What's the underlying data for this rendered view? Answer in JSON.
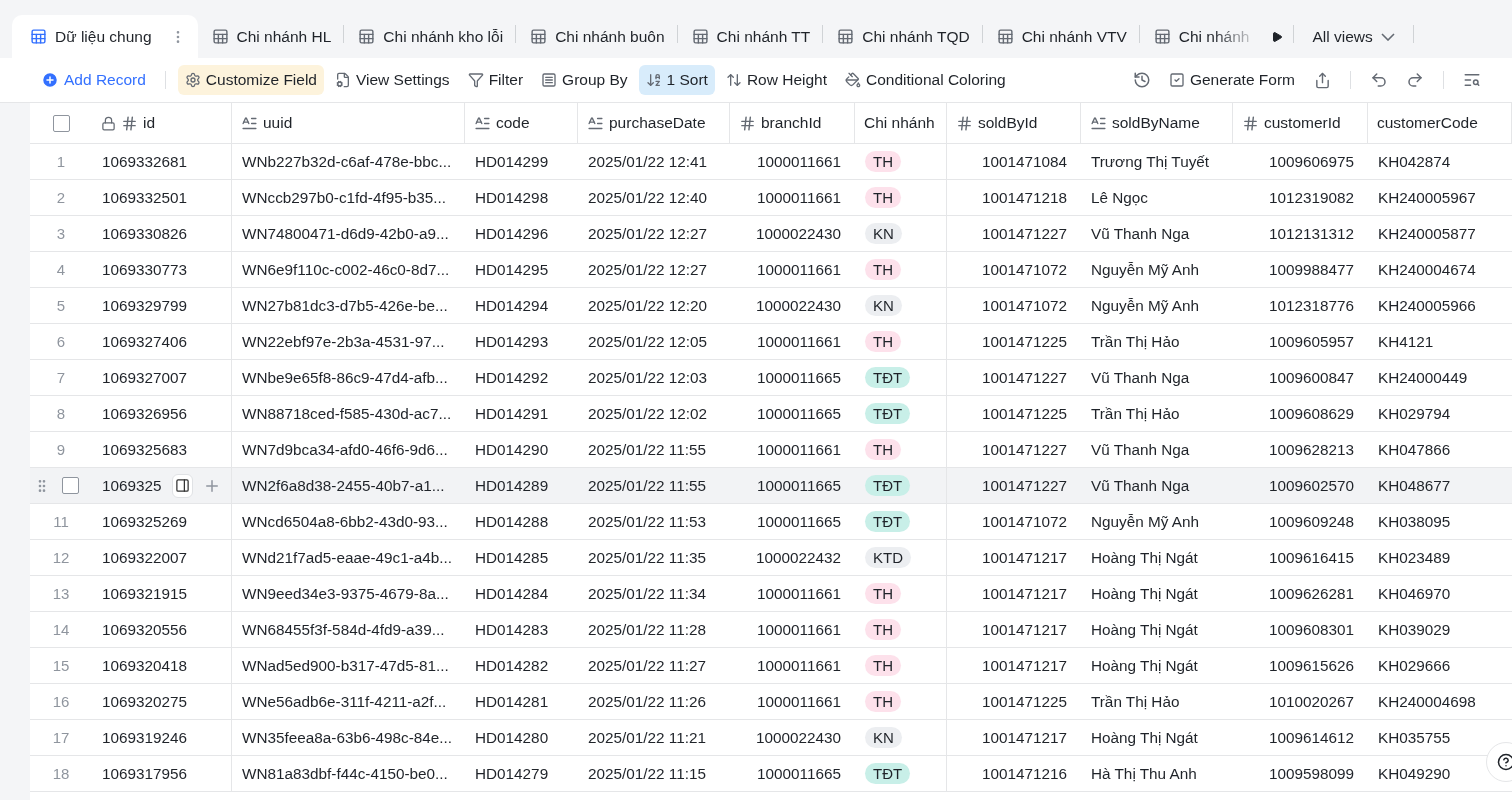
{
  "tabs": [
    {
      "label": "Dữ liệu chung",
      "selected": true
    },
    {
      "label": "Chi nhánh HL",
      "selected": false
    },
    {
      "label": "Chi nhánh kho lỗi",
      "selected": false
    },
    {
      "label": "Chi nhánh buôn",
      "selected": false
    },
    {
      "label": "Chi nhánh TT",
      "selected": false
    },
    {
      "label": "Chi nhánh TQD",
      "selected": false
    },
    {
      "label": "Chi nhánh VTV",
      "selected": false
    },
    {
      "label": "Chi nhánh",
      "selected": false
    }
  ],
  "all_views": "All views",
  "toolbar": [
    {
      "kind": "add",
      "label": "Add Record"
    },
    {
      "kind": "customize",
      "label": "Customize Field",
      "active": true
    },
    {
      "kind": "view-settings",
      "label": "View Settings",
      "active": false
    },
    {
      "kind": "filter",
      "label": "Filter",
      "active": false
    },
    {
      "kind": "group",
      "label": "Group By",
      "active": false
    },
    {
      "kind": "sort",
      "label": "1 Sort",
      "active": true
    },
    {
      "kind": "row-height",
      "label": "Row Height",
      "active": false
    },
    {
      "kind": "coloring",
      "label": "Conditional Coloring",
      "active": false
    }
  ],
  "generate_form": "Generate Form",
  "table": {
    "all_checked": false,
    "columns": [
      {
        "name": "id",
        "kind": "id"
      },
      {
        "name": "uuid",
        "kind": "text"
      },
      {
        "name": "code",
        "kind": "text"
      },
      {
        "name": "purchaseDate",
        "kind": "text"
      },
      {
        "name": "branchId",
        "kind": "number"
      },
      {
        "name": "Chi nhánh",
        "kind": "plain"
      },
      {
        "name": "soldById",
        "kind": "number"
      },
      {
        "name": "soldByName",
        "kind": "text"
      },
      {
        "name": "customerId",
        "kind": "number"
      },
      {
        "name": "customerCode",
        "kind": "plain"
      }
    ],
    "rows": [
      {
        "n": "1",
        "hovered": false,
        "cells": [
          "1069332681",
          "WNb227b32d-c6af-478e-bbc...",
          "HD014299",
          "2025/01/22 12:41",
          "1000011661",
          "TH",
          "1001471084",
          "Trương Thị Tuyết",
          "1009606975",
          "KH042874"
        ],
        "color": "#fde1eb"
      },
      {
        "n": "2",
        "hovered": false,
        "cells": [
          "1069332501",
          "WNccb297b0-c1fd-4f95-b35...",
          "HD014298",
          "2025/01/22 12:40",
          "1000011661",
          "TH",
          "1001471218",
          "Lê Ngọc",
          "1012319082",
          "KH240005967"
        ],
        "color": "#fde1eb"
      },
      {
        "n": "3",
        "hovered": false,
        "cells": [
          "1069330826",
          "WN74800471-d6d9-42b0-a9...",
          "HD014296",
          "2025/01/22 12:27",
          "1000022430",
          "KN",
          "1001471227",
          "Vũ Thanh Nga",
          "1012131312",
          "KH240005877"
        ],
        "color": "#eceef1"
      },
      {
        "n": "4",
        "hovered": false,
        "cells": [
          "1069330773",
          "WN6e9f110c-c002-46c0-8d7...",
          "HD014295",
          "2025/01/22 12:27",
          "1000011661",
          "TH",
          "1001471072",
          "Nguyễn Mỹ Anh",
          "1009988477",
          "KH240004674"
        ],
        "color": "#fde1eb"
      },
      {
        "n": "5",
        "hovered": false,
        "cells": [
          "1069329799",
          "WN27b81dc3-d7b5-426e-be...",
          "HD014294",
          "2025/01/22 12:20",
          "1000022430",
          "KN",
          "1001471072",
          "Nguyễn Mỹ Anh",
          "1012318776",
          "KH240005966"
        ],
        "color": "#eceef1"
      },
      {
        "n": "6",
        "hovered": false,
        "cells": [
          "1069327406",
          "WN22ebf97e-2b3a-4531-97...",
          "HD014293",
          "2025/01/22 12:05",
          "1000011661",
          "TH",
          "1001471225",
          "Trần Thị Hảo",
          "1009605957",
          "KH4121"
        ],
        "color": "#fde1eb"
      },
      {
        "n": "7",
        "hovered": false,
        "cells": [
          "1069327007",
          "WNbe9e65f8-86c9-47d4-afb...",
          "HD014292",
          "2025/01/22 12:03",
          "1000011665",
          "TĐT",
          "1001471227",
          "Vũ Thanh Nga",
          "1009600847",
          "KH24000449"
        ],
        "color": "#c8efe8"
      },
      {
        "n": "8",
        "hovered": false,
        "cells": [
          "1069326956",
          "WN88718ced-f585-430d-ac7...",
          "HD014291",
          "2025/01/22 12:02",
          "1000011665",
          "TĐT",
          "1001471225",
          "Trần Thị Hảo",
          "1009608629",
          "KH029794"
        ],
        "color": "#c8efe8"
      },
      {
        "n": "9",
        "hovered": false,
        "cells": [
          "1069325683",
          "WN7d9bca34-afd0-46f6-9d6...",
          "HD014290",
          "2025/01/22 11:55",
          "1000011661",
          "TH",
          "1001471227",
          "Vũ Thanh Nga",
          "1009628213",
          "KH047866"
        ],
        "color": "#fde1eb"
      },
      {
        "hovered": true,
        "checked": false,
        "cells": [
          "1069325",
          "WN2f6a8d38-2455-40b7-a1...",
          "HD014289",
          "2025/01/22 11:55",
          "1000011665",
          "TĐT",
          "1001471227",
          "Vũ Thanh Nga",
          "1009602570",
          "KH048677"
        ],
        "color": "#c8efe8"
      },
      {
        "n": "11",
        "hovered": false,
        "cells": [
          "1069325269",
          "WNcd6504a8-6bb2-43d0-93...",
          "HD014288",
          "2025/01/22 11:53",
          "1000011665",
          "TĐT",
          "1001471072",
          "Nguyễn Mỹ Anh",
          "1009609248",
          "KH038095"
        ],
        "color": "#c8efe8"
      },
      {
        "n": "12",
        "hovered": false,
        "cells": [
          "1069322007",
          "WNd21f7ad5-eaae-49c1-a4b...",
          "HD014285",
          "2025/01/22 11:35",
          "1000022432",
          "KTD",
          "1001471217",
          "Hoàng Thị Ngát",
          "1009616415",
          "KH023489"
        ],
        "color": "#eceef1"
      },
      {
        "n": "13",
        "hovered": false,
        "cells": [
          "1069321915",
          "WN9eed34e3-9375-4679-8a...",
          "HD014284",
          "2025/01/22 11:34",
          "1000011661",
          "TH",
          "1001471217",
          "Hoàng Thị Ngát",
          "1009626281",
          "KH046970"
        ],
        "color": "#fde1eb"
      },
      {
        "n": "14",
        "hovered": false,
        "cells": [
          "1069320556",
          "WN68455f3f-584d-4fd9-a39...",
          "HD014283",
          "2025/01/22 11:28",
          "1000011661",
          "TH",
          "1001471217",
          "Hoàng Thị Ngát",
          "1009608301",
          "KH039029"
        ],
        "color": "#fde1eb"
      },
      {
        "n": "15",
        "hovered": false,
        "cells": [
          "1069320418",
          "WNad5ed900-b317-47d5-81...",
          "HD014282",
          "2025/01/22 11:27",
          "1000011661",
          "TH",
          "1001471217",
          "Hoàng Thị Ngát",
          "1009615626",
          "KH029666"
        ],
        "color": "#fde1eb"
      },
      {
        "n": "16",
        "hovered": false,
        "cells": [
          "1069320275",
          "WNe56adb6e-311f-4211-a2f...",
          "HD014281",
          "2025/01/22 11:26",
          "1000011661",
          "TH",
          "1001471225",
          "Trần Thị Hảo",
          "1010020267",
          "KH240004698"
        ],
        "color": "#fde1eb"
      },
      {
        "n": "17",
        "hovered": false,
        "cells": [
          "1069319246",
          "WN35feea8a-63b6-498c-84e...",
          "HD014280",
          "2025/01/22 11:21",
          "1000022430",
          "KN",
          "1001471217",
          "Hoàng Thị Ngát",
          "1009614612",
          "KH035755"
        ],
        "color": "#eceef1"
      },
      {
        "n": "18",
        "hovered": false,
        "cells": [
          "1069317956",
          "WN81a83dbf-f44c-4150-be0...",
          "HD014279",
          "2025/01/22 11:15",
          "1000011665",
          "TĐT",
          "1001471216",
          "Hà Thị Thu Anh",
          "1009598099",
          "KH049290"
        ],
        "color": "#c8efe8"
      }
    ]
  }
}
